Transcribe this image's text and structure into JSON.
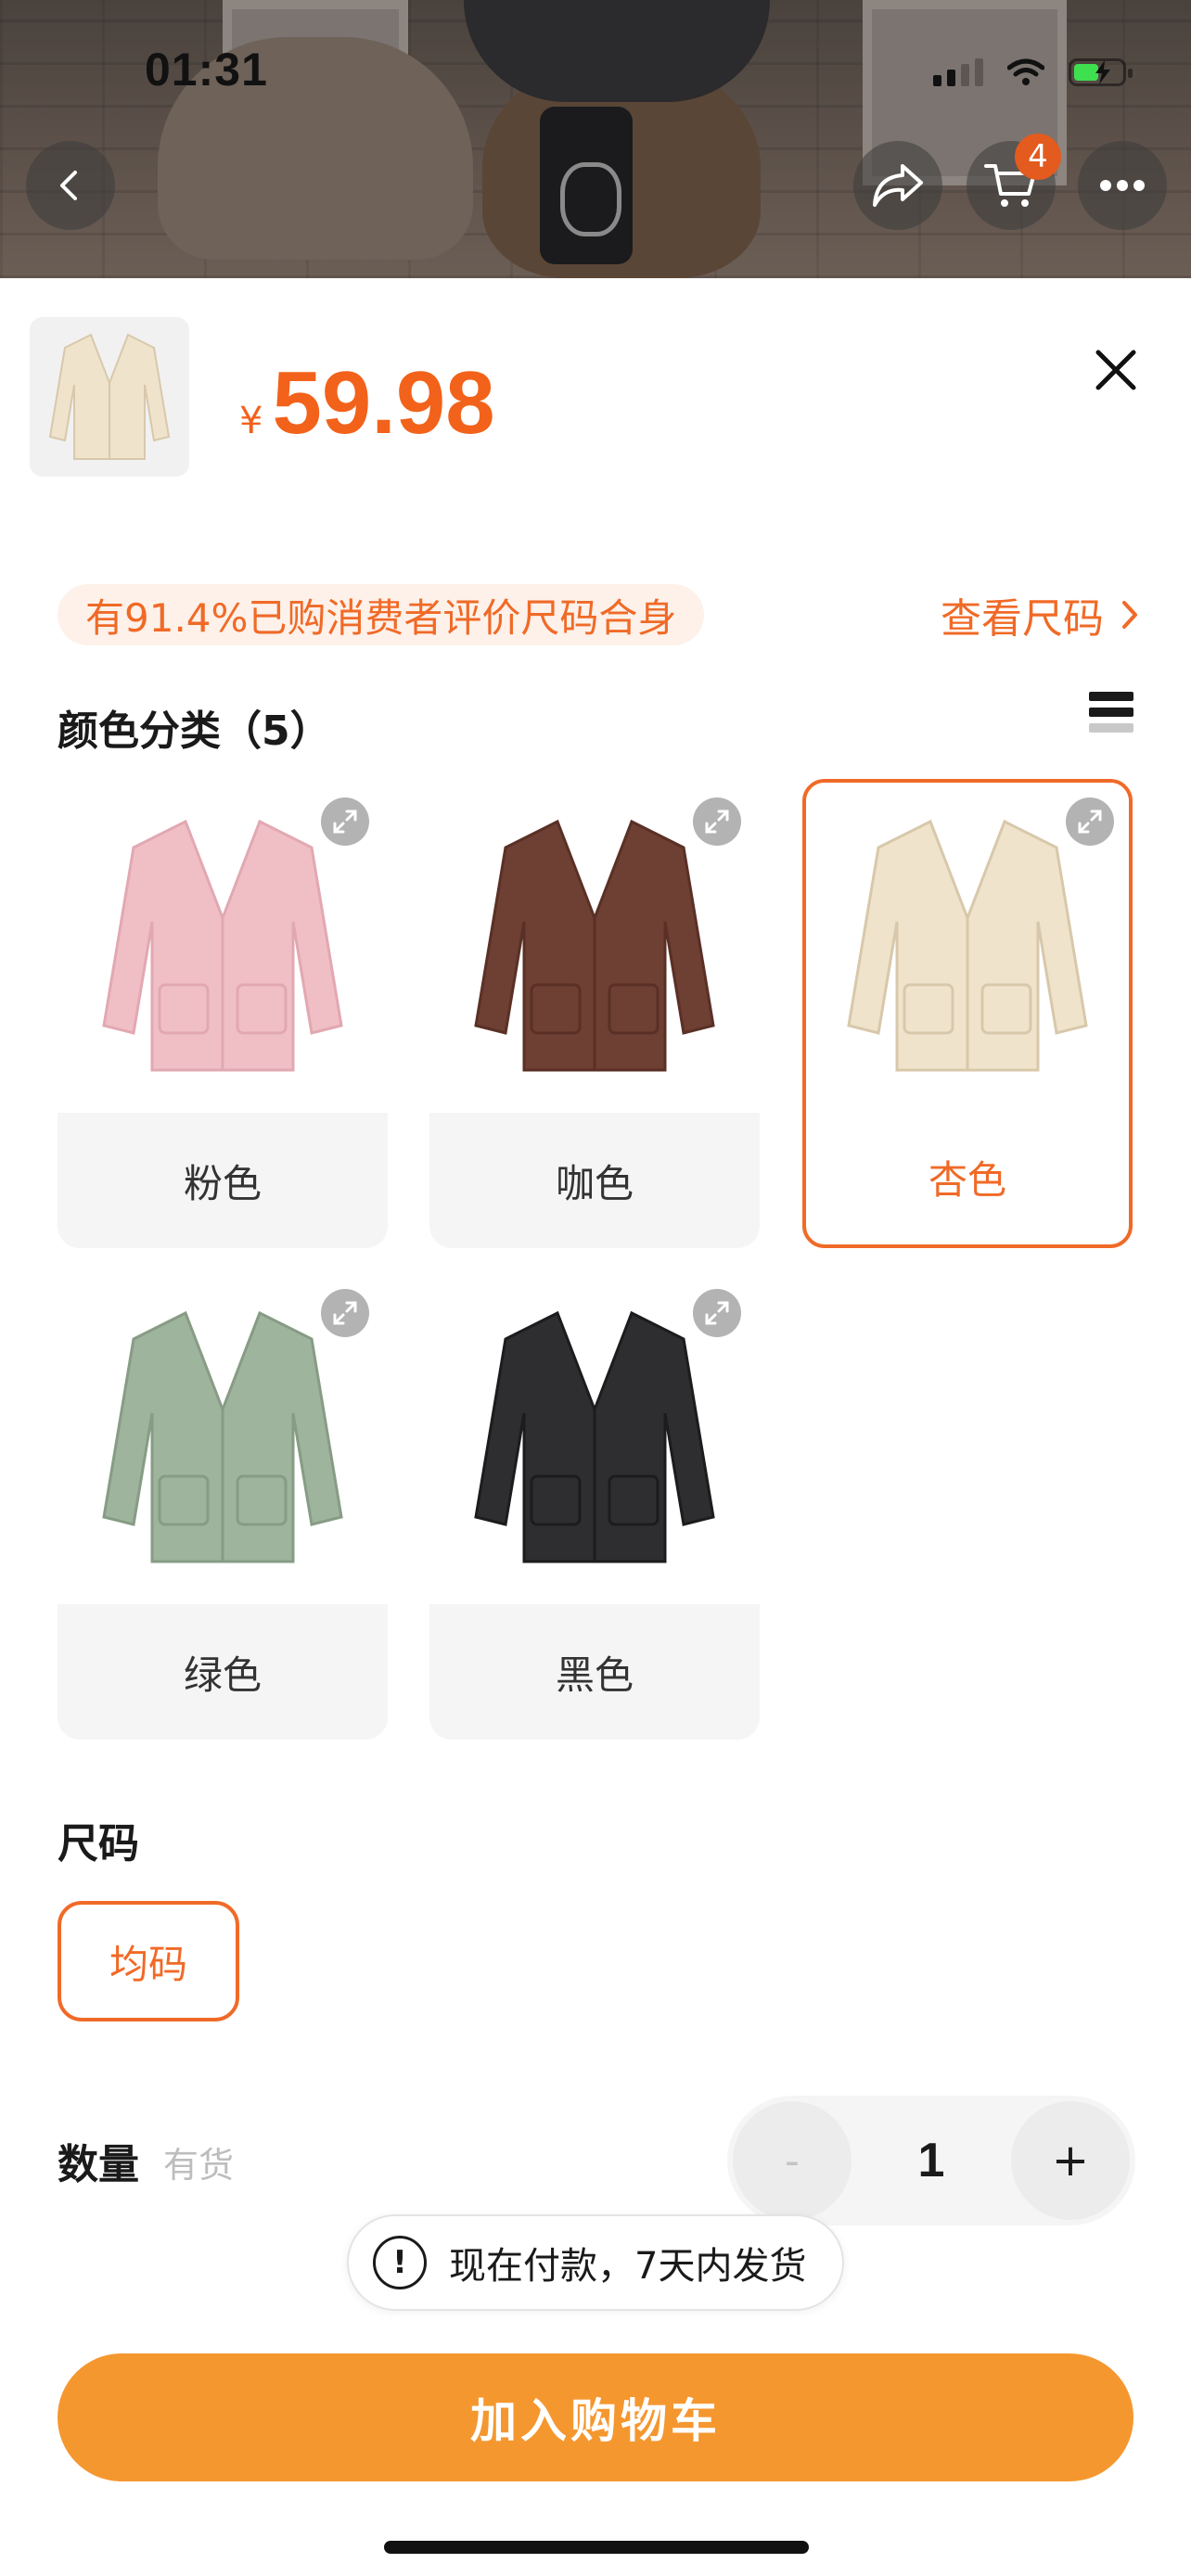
{
  "status_bar": {
    "time": "01:31"
  },
  "header": {
    "cart_count": "4"
  },
  "product": {
    "currency": "¥",
    "price": "59.98",
    "colors": {
      "beige": "#efe3cc",
      "pink": "#f0bfc6",
      "brown": "#6e3f33",
      "green": "#9fb49c",
      "black": "#2e2e30"
    }
  },
  "fit": {
    "text": "有91.4%已购消费者评价尺码合身",
    "link_label": "查看尺码"
  },
  "color_section": {
    "title": "颜色分类（5）",
    "options": [
      {
        "label": "粉色",
        "selected": false
      },
      {
        "label": "咖色",
        "selected": false
      },
      {
        "label": "杏色",
        "selected": true
      },
      {
        "label": "绿色",
        "selected": false
      },
      {
        "label": "黑色",
        "selected": false
      }
    ]
  },
  "size_section": {
    "title": "尺码",
    "options": [
      "均码"
    ]
  },
  "quantity": {
    "title": "数量",
    "stock": "有货",
    "value": "1",
    "minus": "-",
    "plus": "+"
  },
  "notice": {
    "text": "现在付款，7天内发货"
  },
  "actions": {
    "add_to_cart": "加入购物车"
  },
  "accent_color": "#f06a27",
  "button_color": "#f5972f"
}
